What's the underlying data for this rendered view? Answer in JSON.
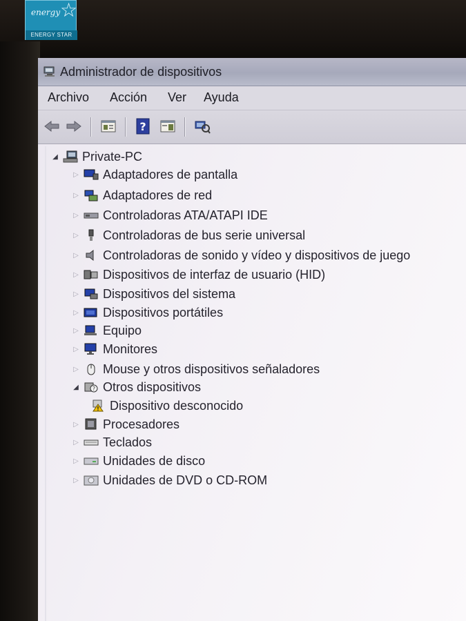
{
  "badge": {
    "script": "energy",
    "label": "ENERGY STAR"
  },
  "window": {
    "title": "Administrador de dispositivos"
  },
  "menu": {
    "file": "Archivo",
    "action": "Acción",
    "view": "Ver",
    "help": "Ayuda"
  },
  "toolbar": {
    "buttons": [
      "back-icon",
      "forward-icon",
      "properties-icon",
      "help-icon",
      "show-hide-pane-icon",
      "scan-hardware-icon"
    ]
  },
  "tree": {
    "root": "Private-PC",
    "categories": [
      {
        "label": "Adaptadores de pantalla",
        "icon": "display-adapter-icon",
        "expanded": false
      },
      {
        "label": "Adaptadores de red",
        "icon": "network-adapter-icon",
        "expanded": false
      },
      {
        "label": "Controladoras ATA/ATAPI IDE",
        "icon": "ide-controller-icon",
        "expanded": false
      },
      {
        "label": "Controladoras de bus serie universal",
        "icon": "usb-controller-icon",
        "expanded": false
      },
      {
        "label": "Controladoras de sonido y vídeo y dispositivos de juego",
        "icon": "sound-video-icon",
        "expanded": false
      },
      {
        "label": "Dispositivos de interfaz de usuario (HID)",
        "icon": "hid-icon",
        "expanded": false
      },
      {
        "label": "Dispositivos del sistema",
        "icon": "system-device-icon",
        "expanded": false
      },
      {
        "label": "Dispositivos portátiles",
        "icon": "portable-device-icon",
        "expanded": false
      },
      {
        "label": "Equipo",
        "icon": "computer-icon",
        "expanded": false
      },
      {
        "label": "Monitores",
        "icon": "monitor-icon",
        "expanded": false
      },
      {
        "label": "Mouse y otros dispositivos señaladores",
        "icon": "mouse-icon",
        "expanded": false
      },
      {
        "label": "Otros dispositivos",
        "icon": "other-devices-icon",
        "expanded": true
      },
      {
        "label": "Dispositivo desconocido",
        "icon": "unknown-device-warning-icon",
        "child": true
      },
      {
        "label": "Procesadores",
        "icon": "processor-icon",
        "expanded": false
      },
      {
        "label": "Teclados",
        "icon": "keyboard-icon",
        "expanded": false
      },
      {
        "label": "Unidades de disco",
        "icon": "disk-drive-icon",
        "expanded": false
      },
      {
        "label": "Unidades de DVD o CD-ROM",
        "icon": "dvd-drive-icon",
        "expanded": false
      }
    ]
  }
}
